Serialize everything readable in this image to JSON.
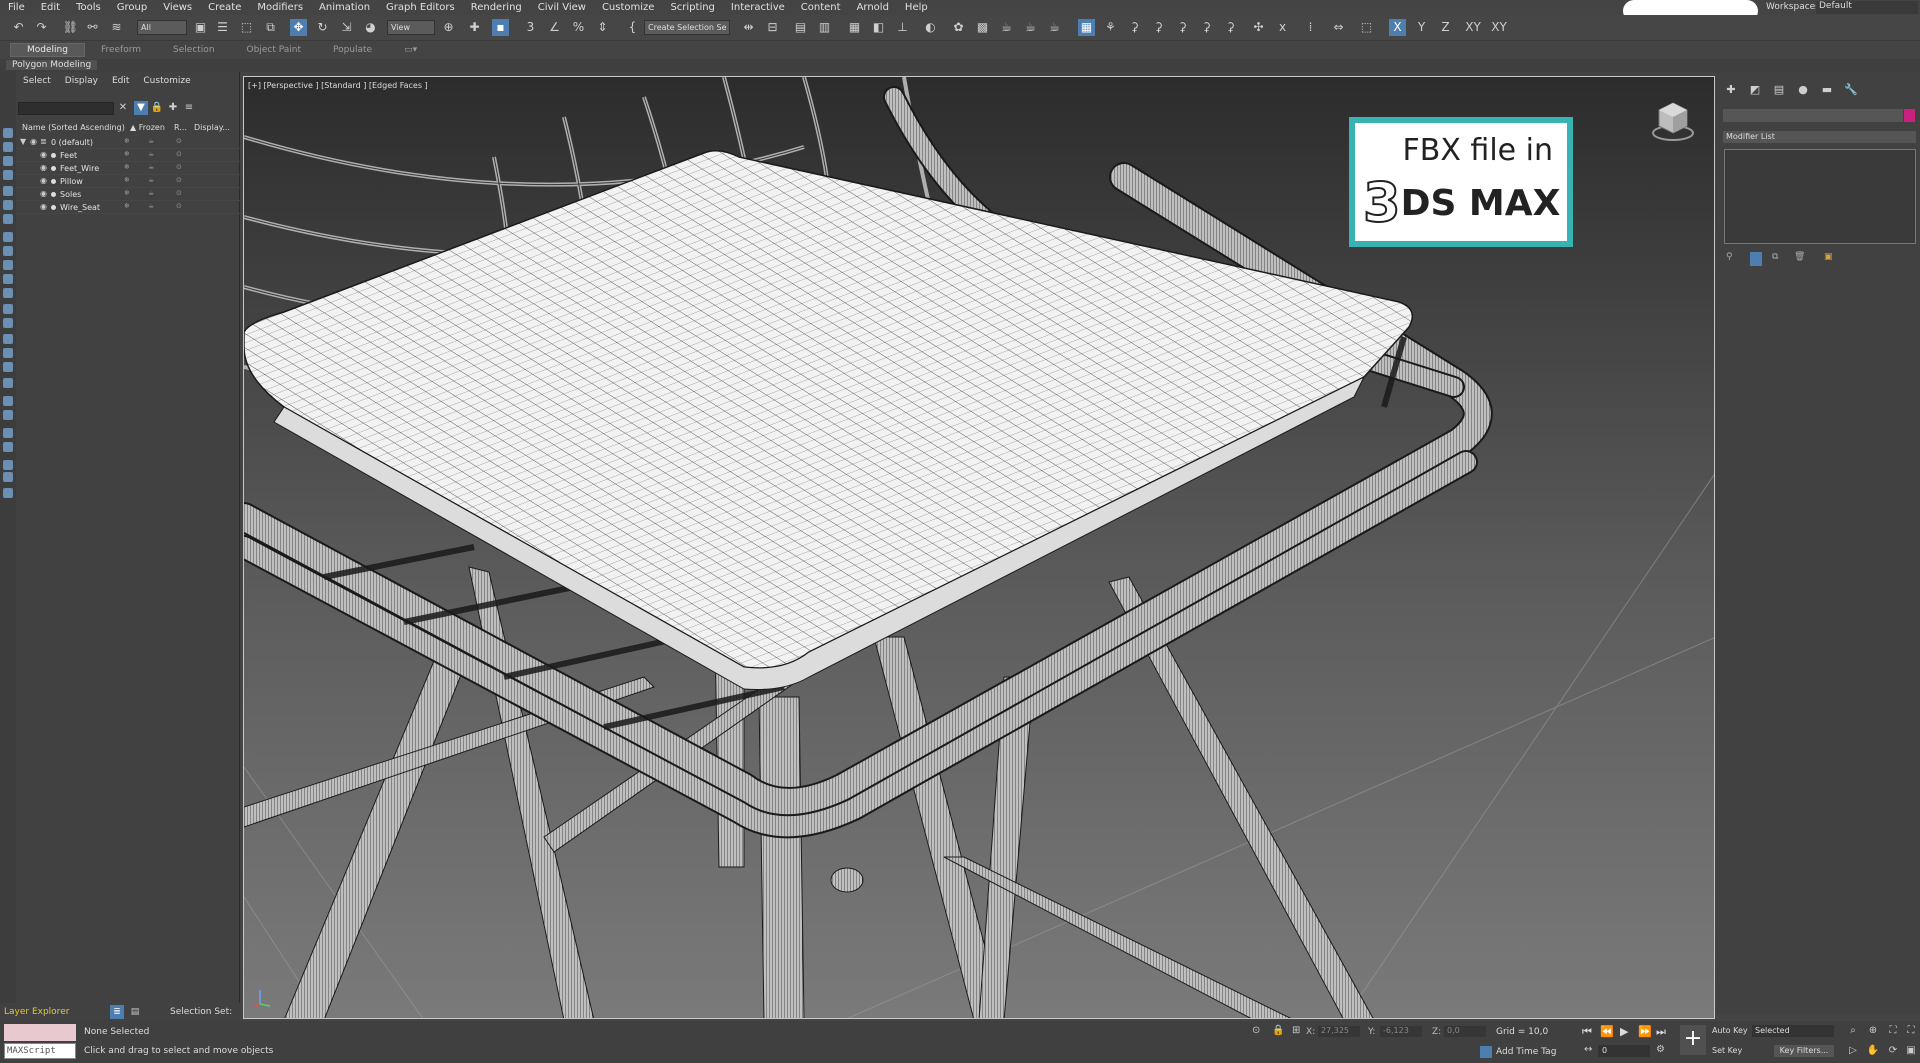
{
  "menu": [
    "File",
    "Edit",
    "Tools",
    "Group",
    "Views",
    "Create",
    "Modifiers",
    "Animation",
    "Graph Editors",
    "Rendering",
    "Civil View",
    "Customize",
    "Scripting",
    "Interactive",
    "Content",
    "Arnold",
    "Help"
  ],
  "workspaces": {
    "label": "Workspaces:",
    "value": "Default"
  },
  "toolbar": {
    "filter_value": "All",
    "coord_value": "View",
    "selection_set": "Create Selection Se",
    "axis_x": "X",
    "axis_y": "Y",
    "axis_z": "Z",
    "axis_xy": "XY",
    "axis_xy2": "XY"
  },
  "ribbon_tabs": [
    "Modeling",
    "Freeform",
    "Selection",
    "Object Paint",
    "Populate"
  ],
  "polygon_modeling": "Polygon Modeling",
  "explorer": {
    "menu": [
      "Select",
      "Display",
      "Edit",
      "Customize"
    ],
    "columns": {
      "name": "Name (Sorted Ascending)",
      "frozen": "▲ Frozen",
      "render": "R...",
      "display": "Display..."
    },
    "layer": "0 (default)",
    "objects": [
      "Feet",
      "Feet_Wire",
      "Pillow",
      "Soles",
      "Wire_Seat"
    ],
    "footer_label": "Layer Explorer",
    "selection_set": "Selection Set:"
  },
  "viewport": {
    "label": "[+] [Perspective ] [Standard ] [Edged Faces ]",
    "badge_line1": "FBX file in",
    "badge_three": "3",
    "badge_line2": "DS MAX"
  },
  "command_panel": {
    "modifier_list": "Modifier List"
  },
  "status": {
    "maxscript": "MAXScript Mi:",
    "selection": "None Selected",
    "hint": "Click and drag to select and move objects",
    "x_label": "X:",
    "x_value": "27,325",
    "y_label": "Y:",
    "y_value": "-6,123",
    "z_label": "Z:",
    "z_value": "0,0",
    "grid": "Grid = 10,0",
    "add_time_tag": "Add Time Tag",
    "auto_key": "Auto Key",
    "set_key": "Set Key",
    "selected": "Selected",
    "key_filters": "Key Filters...",
    "frame": "0"
  },
  "colors": {
    "accent": "#4c7fb0",
    "badge_border": "#37b3b3",
    "object_color": "#c8227e",
    "maxscript_bg": "#e8c9cf",
    "layer_label": "#e6c830"
  }
}
